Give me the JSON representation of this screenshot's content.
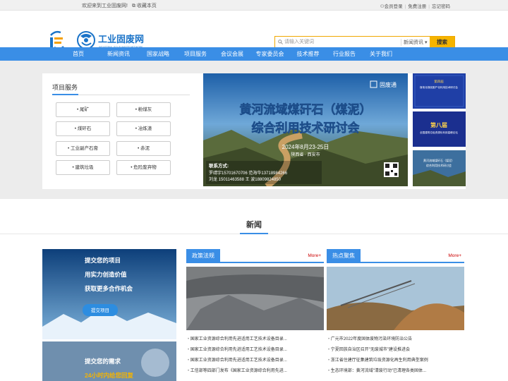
{
  "topbar": {
    "welcome": "欢迎来到工业固废网!",
    "bookmark": "收藏本页",
    "login": "会员登录",
    "register": "免费注册",
    "forgot": "忘记密码"
  },
  "logo": {
    "name": "工业固废网",
    "sub": "INDUSTRIAL SOLID WASTE NETWORK"
  },
  "search": {
    "placeholder": "请输入关键词",
    "category": "新闻资讯",
    "button": "搜索"
  },
  "nav": [
    "首页",
    "新闻资讯",
    "国家战略",
    "项目服务",
    "会议会展",
    "专家委员会",
    "技术推荐",
    "行业报告",
    "关于我们"
  ],
  "services": {
    "title": "项目服务",
    "items": [
      "尾矿",
      "粉煤灰",
      "煤矸石",
      "冶炼渣",
      "工业副产石膏",
      "赤泥",
      "建筑垃圾",
      "危险废弃物"
    ]
  },
  "banner": {
    "brand": "固废通",
    "line1": "黄河流域煤矸石（煤泥）",
    "line2": "综合利用技术研讨会",
    "date": "2024年8月23-25日",
    "place": "陕西省 · 西安市",
    "contact_title": "联系方式:",
    "contact1": "罗靖宇15701670706  范海华13718984266",
    "contact2": "刘龙  15011463588  王  波18809824850"
  },
  "thumbs": [
    {
      "l1": "第四届",
      "l2": "煤电化煤炭副产化利用技术研讨会"
    },
    {
      "l1": "第八届",
      "l2": "全国建筑垃圾资源化利用高峰论坛"
    },
    {
      "l1": "黄河流域煤矸石（煤泥）",
      "l2": "综合利用技术研讨会"
    }
  ],
  "section": {
    "title": "新闻"
  },
  "ads": [
    {
      "l1": "提交您的项目",
      "l2": "用实力创造价值",
      "l3": "获取更多合作机会",
      "btn": "提交项目"
    },
    {
      "l1": "提交您的需求",
      "l2": "24小时内给您回复"
    }
  ],
  "policy": {
    "title": "政策法规",
    "more": "More+",
    "items": [
      "国家工业资源综合利用先进适用工艺技术设备目录...",
      "国家工业资源综合利用先进适用工艺技术设备目录...",
      "国家工业资源综合利用先进适用工艺技术设备目录...",
      "工信部等四部门发布《国家工业资源综合利用先进..."
    ]
  },
  "hot": {
    "title": "热点聚焦",
    "more": "More+",
    "items": [
      "广元市2022年度固体废物污染环境防治公告",
      "宁夏回族自治区召开\"无废城市\"建设推进会",
      "浙江省住建厅征集建筑垃圾资源化再生利用典型案例",
      "生态环境部：黄河流域\"清废行动\"已清理各类固体..."
    ]
  }
}
